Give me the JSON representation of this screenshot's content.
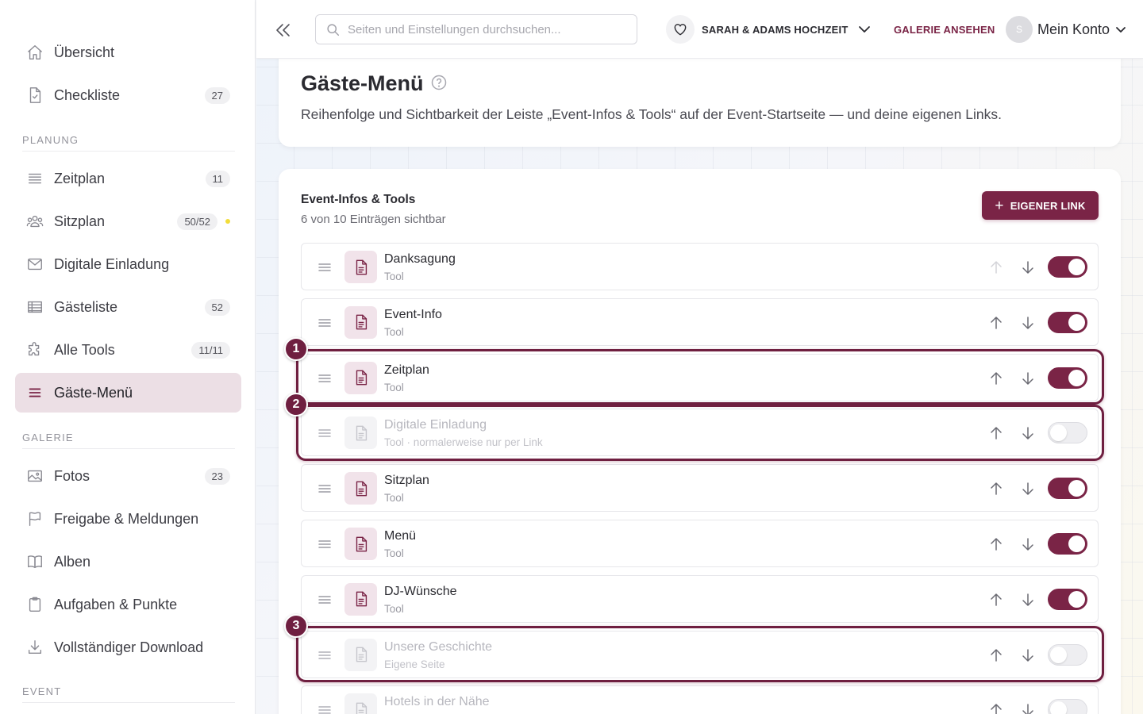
{
  "sidebar": {
    "items_top": [
      {
        "label": "Übersicht",
        "icon": "home-icon"
      },
      {
        "label": "Checkliste",
        "icon": "checklist-icon",
        "badge": "27"
      }
    ],
    "sections": [
      {
        "label": "PLANUNG"
      },
      {
        "label": "GALERIE"
      },
      {
        "label": "EVENT"
      }
    ],
    "planung": [
      {
        "label": "Zeitplan",
        "icon": "timeline-icon",
        "badge": "11"
      },
      {
        "label": "Sitzplan",
        "icon": "people-icon",
        "badge": "50/52",
        "dot_color": "#f2dd3a"
      },
      {
        "label": "Digitale Einladung",
        "icon": "mail-icon"
      },
      {
        "label": "Gästeliste",
        "icon": "table-icon",
        "badge": "52"
      },
      {
        "label": "Alle Tools",
        "icon": "puzzle-icon",
        "badge": "11/11"
      },
      {
        "label": "Gäste-Menü",
        "icon": "menu-icon",
        "active": true
      }
    ],
    "galerie": [
      {
        "label": "Fotos",
        "icon": "image-icon",
        "badge": "23"
      },
      {
        "label": "Freigabe & Meldungen",
        "icon": "flag-icon"
      },
      {
        "label": "Alben",
        "icon": "book-icon"
      },
      {
        "label": "Aufgaben & Punkte",
        "icon": "clipboard-icon"
      },
      {
        "label": "Vollständiger Download",
        "icon": "download-icon"
      }
    ]
  },
  "topbar": {
    "search_placeholder": "Seiten und Einstellungen durchsuchen...",
    "event_name": "SARAH & ADAMS HOCHZEIT",
    "gallery_link": "GALERIE ANSEHEN",
    "avatar_initial": "S",
    "account_label": "Mein Konto"
  },
  "page": {
    "title": "Gäste-Menü",
    "description": "Reihenfolge und Sichtbarkeit der Leiste „Event-Infos & Tools“ auf der Event-Startseite — und deine eigenen Links."
  },
  "list": {
    "title": "Event-Infos & Tools",
    "subtitle": "6 von 10 Einträgen sichtbar",
    "add_button": "EIGENER LINK",
    "rows": [
      {
        "title": "Danksagung",
        "sub": "Tool",
        "enabled": true
      },
      {
        "title": "Event-Info",
        "sub": "Tool",
        "enabled": true
      },
      {
        "title": "Zeitplan",
        "sub": "Tool",
        "enabled": true
      },
      {
        "title": "Digitale Einladung",
        "sub": "Tool · normalerweise nur per Link",
        "enabled": false
      },
      {
        "title": "Sitzplan",
        "sub": "Tool",
        "enabled": true
      },
      {
        "title": "Menü",
        "sub": "Tool",
        "enabled": true
      },
      {
        "title": "DJ-Wünsche",
        "sub": "Tool",
        "enabled": true
      },
      {
        "title": "Unsere Geschichte",
        "sub": "Eigene Seite",
        "enabled": false
      },
      {
        "title": "Hotels in der Nähe",
        "sub": "",
        "enabled": false
      }
    ]
  },
  "annotations": [
    "1",
    "2",
    "3"
  ],
  "colors": {
    "accent": "#7a2446",
    "active_bg": "#ecdfe5",
    "dot": "#f2dd3a"
  }
}
